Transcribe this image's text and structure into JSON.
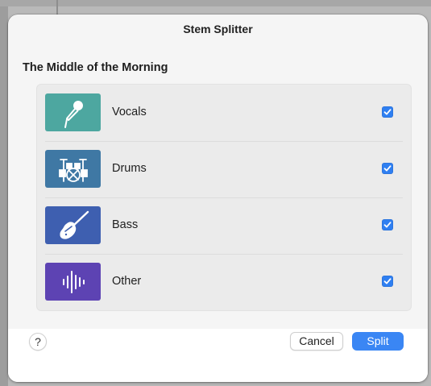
{
  "dialog": {
    "title": "Stem Splitter",
    "song_title": "The Middle of the Morning"
  },
  "stems": [
    {
      "label": "Vocals",
      "icon": "microphone-icon",
      "color": "#4da7a0",
      "checked": true
    },
    {
      "label": "Drums",
      "icon": "drum-kit-icon",
      "color": "#3f78a4",
      "checked": true
    },
    {
      "label": "Bass",
      "icon": "bass-guitar-icon",
      "color": "#3e5fb0",
      "checked": true
    },
    {
      "label": "Other",
      "icon": "waveform-icon",
      "color": "#5d43b3",
      "checked": true
    }
  ],
  "footer": {
    "help_label": "?",
    "cancel_label": "Cancel",
    "split_label": "Split"
  },
  "colors": {
    "accent": "#3a86f4",
    "checkbox": "#2f7ff1"
  }
}
